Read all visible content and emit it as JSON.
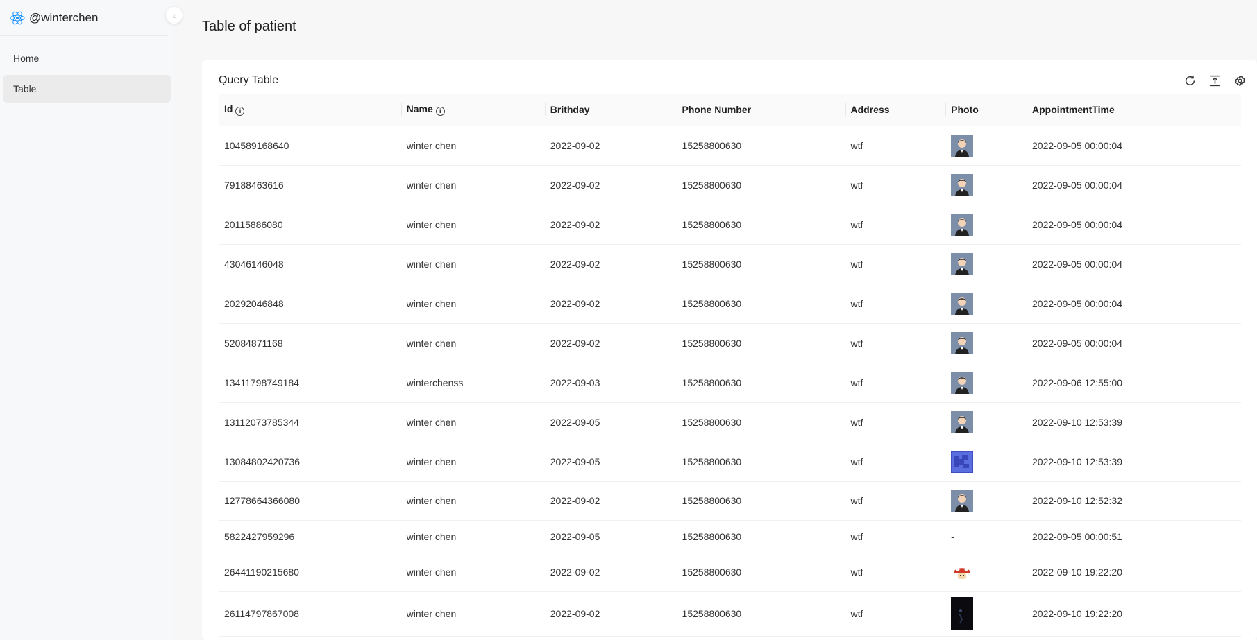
{
  "sidebar": {
    "brand": "@winterchen",
    "collapse_glyph": "‹",
    "items": [
      {
        "label": "Home",
        "active": false
      },
      {
        "label": "Table",
        "active": true
      }
    ]
  },
  "page": {
    "title": "Table of patient"
  },
  "card": {
    "title": "Query Table",
    "tools": [
      "reload-icon",
      "density-icon",
      "settings-icon"
    ]
  },
  "table": {
    "columns": [
      "Id",
      "Name",
      "Brithday",
      "Phone Number",
      "Address",
      "Photo",
      "AppointmentTime"
    ],
    "rows": [
      {
        "id": "104589168640",
        "name": "winter chen",
        "birthday": "2022-09-02",
        "phone": "15258800630",
        "address": "wtf",
        "photo": "avatar",
        "time": "2022-09-05 00:00:04"
      },
      {
        "id": "79188463616",
        "name": "winter chen",
        "birthday": "2022-09-02",
        "phone": "15258800630",
        "address": "wtf",
        "photo": "avatar",
        "time": "2022-09-05 00:00:04"
      },
      {
        "id": "20115886080",
        "name": "winter chen",
        "birthday": "2022-09-02",
        "phone": "15258800630",
        "address": "wtf",
        "photo": "avatar",
        "time": "2022-09-05 00:00:04"
      },
      {
        "id": "43046146048",
        "name": "winter chen",
        "birthday": "2022-09-02",
        "phone": "15258800630",
        "address": "wtf",
        "photo": "avatar",
        "time": "2022-09-05 00:00:04"
      },
      {
        "id": "20292046848",
        "name": "winter chen",
        "birthday": "2022-09-02",
        "phone": "15258800630",
        "address": "wtf",
        "photo": "avatar",
        "time": "2022-09-05 00:00:04"
      },
      {
        "id": "52084871168",
        "name": "winter chen",
        "birthday": "2022-09-02",
        "phone": "15258800630",
        "address": "wtf",
        "photo": "avatar",
        "time": "2022-09-05 00:00:04"
      },
      {
        "id": "13411798749184",
        "name": "winterchenss",
        "birthday": "2022-09-03",
        "phone": "15258800630",
        "address": "wtf",
        "photo": "avatar",
        "time": "2022-09-06 12:55:00"
      },
      {
        "id": "13112073785344",
        "name": "winter chen",
        "birthday": "2022-09-05",
        "phone": "15258800630",
        "address": "wtf",
        "photo": "avatar",
        "time": "2022-09-10 12:53:39"
      },
      {
        "id": "13084802420736",
        "name": "winter chen",
        "birthday": "2022-09-05",
        "phone": "15258800630",
        "address": "wtf",
        "photo": "blue",
        "time": "2022-09-10 12:53:39"
      },
      {
        "id": "12778664366080",
        "name": "winter chen",
        "birthday": "2022-09-02",
        "phone": "15258800630",
        "address": "wtf",
        "photo": "avatar",
        "time": "2022-09-10 12:52:32"
      },
      {
        "id": "5822427959296",
        "name": "winter chen",
        "birthday": "2022-09-05",
        "phone": "15258800630",
        "address": "wtf",
        "photo": "-",
        "time": "2022-09-05 00:00:51"
      },
      {
        "id": "26441190215680",
        "name": "winter chen",
        "birthday": "2022-09-02",
        "phone": "15258800630",
        "address": "wtf",
        "photo": "mushroom",
        "time": "2022-09-10 19:22:20"
      },
      {
        "id": "26114797867008",
        "name": "winter chen",
        "birthday": "2022-09-02",
        "phone": "15258800630",
        "address": "wtf",
        "photo": "dark",
        "time": "2022-09-10 19:22:20"
      }
    ]
  }
}
